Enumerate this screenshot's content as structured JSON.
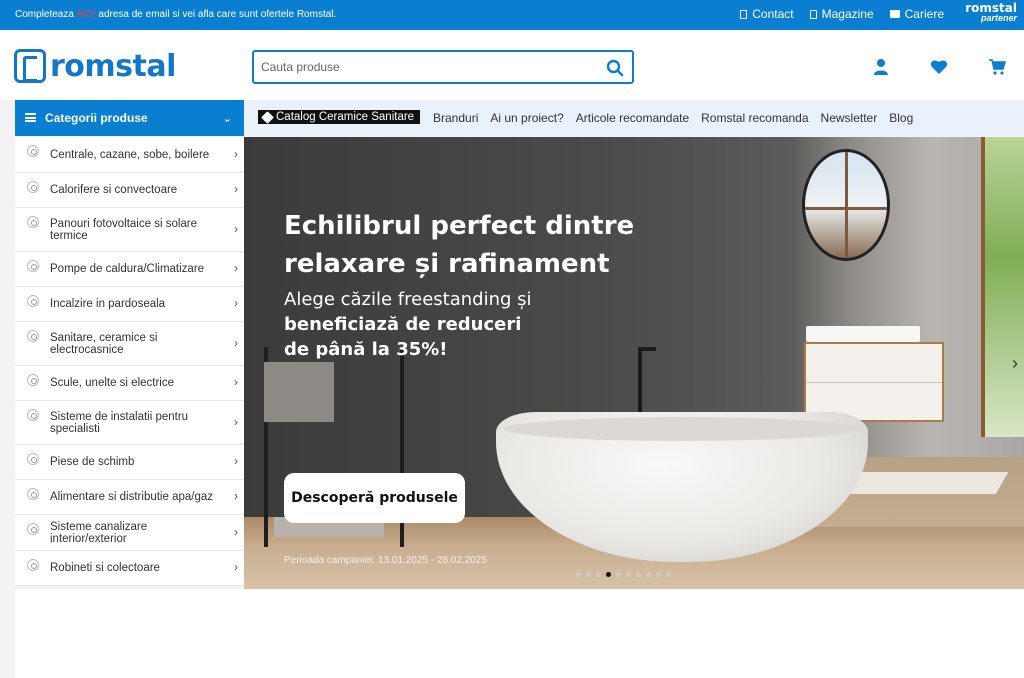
{
  "topbar": {
    "promo_before": "Completeaza ",
    "promo_link": "AICI",
    "promo_after": " adresa de email si vei afla care sunt ofertele Romstal.",
    "links": [
      "Contact",
      "Magazine",
      "Cariere"
    ],
    "partner_line1": "romstal",
    "partner_line2": "partener"
  },
  "header": {
    "logo_text": "romstal",
    "search_placeholder": "Cauta produse",
    "icons": [
      "user-icon",
      "heart-icon",
      "cart-icon"
    ]
  },
  "sidebar": {
    "title": "Categorii produse",
    "items": [
      {
        "label": "Centrale, cazane, sobe, boilere",
        "h": 36
      },
      {
        "label": "Calorifere si convectoare",
        "h": 35
      },
      {
        "label": "Panouri fotovoltaice si solare termice",
        "h": 44
      },
      {
        "label": "Pompe de caldura/Climatizare",
        "h": 35
      },
      {
        "label": "Incalzire in pardoseala",
        "h": 35
      },
      {
        "label": "Sanitare, ceramice si electrocasnice",
        "h": 44
      },
      {
        "label": "Scule, unelte si electrice",
        "h": 35
      },
      {
        "label": "Sisteme de instalatii pentru specialisti",
        "h": 44
      },
      {
        "label": "Piese de schimb",
        "h": 35
      },
      {
        "label": "Alimentare si distributie apa/gaz",
        "h": 35
      },
      {
        "label": "Sisteme canalizare interior/exterior",
        "h": 36
      },
      {
        "label": "Robineti si colectoare",
        "h": 35
      }
    ]
  },
  "navbar": {
    "catalog": "Catalog Ceramice Sanitare",
    "items": [
      "Branduri",
      "Ai un proiect?",
      "Articole recomandate",
      "Romstal recomanda",
      "Newsletter",
      "Blog"
    ]
  },
  "hero": {
    "title_line1": "Echilibrul perfect dintre",
    "title_line2": "relaxare și rafinament",
    "sub_line1": "Alege căzile freestanding și",
    "sub_line2": "beneficiază de reduceri",
    "sub_line3": "de până la 35%!",
    "cta": "Descoperă produsele",
    "period": "Perioada campaniei: 13.01.2025 - 28.02.2025",
    "slides_total": 10,
    "slide_active": 4
  },
  "colors": {
    "brand_blue": "#0a7ed0",
    "promo_red": "#ff3b3b"
  }
}
